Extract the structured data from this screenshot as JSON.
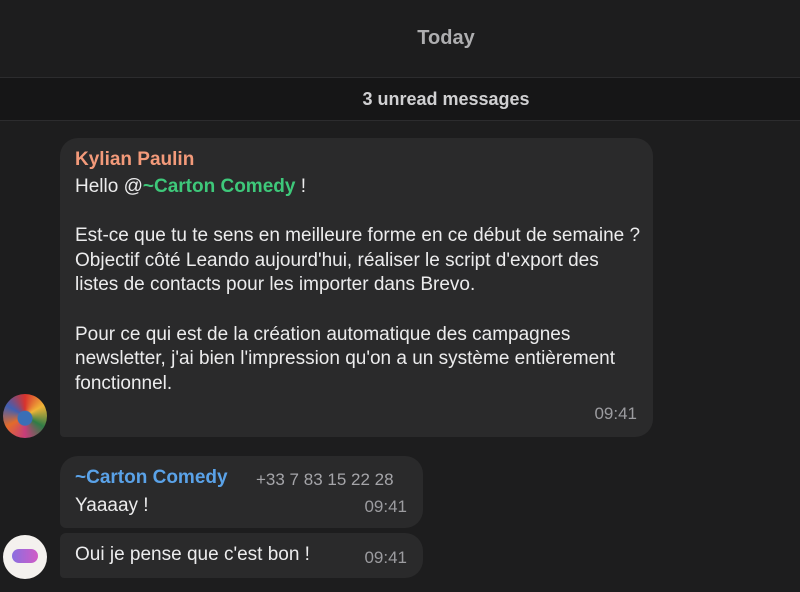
{
  "date_header": "Today",
  "unread_label": "3 unread messages",
  "messages": [
    {
      "sender": "Kylian Paulin",
      "greeting_prefix": "Hello @",
      "mention": "~Carton Comedy",
      "greeting_suffix": " !",
      "paragraph_1": "Est-ce que tu te sens en meilleure forme en ce début de semaine ? Objectif côté Leando aujourd'hui, réaliser le script d'export des listes de contacts pour les importer dans Brevo.",
      "paragraph_2": "Pour ce qui est de la création automatique des campagnes newsletter, j'ai bien l'impression qu'on a un système entièrement fonctionnel.",
      "time": "09:41"
    },
    {
      "sender": "~Carton Comedy",
      "phone": "+33 7 83 15 22 28",
      "text": "Yaaaay !",
      "time": "09:41"
    },
    {
      "text": "Oui je pense que c'est bon !",
      "time": "09:41"
    }
  ],
  "colors": {
    "background": "#1d1d1e",
    "bubble": "#2a2a2b",
    "sender_kylian": "#f39a7a",
    "mention": "#3ec87a",
    "sender_carton": "#5aa2e8"
  }
}
